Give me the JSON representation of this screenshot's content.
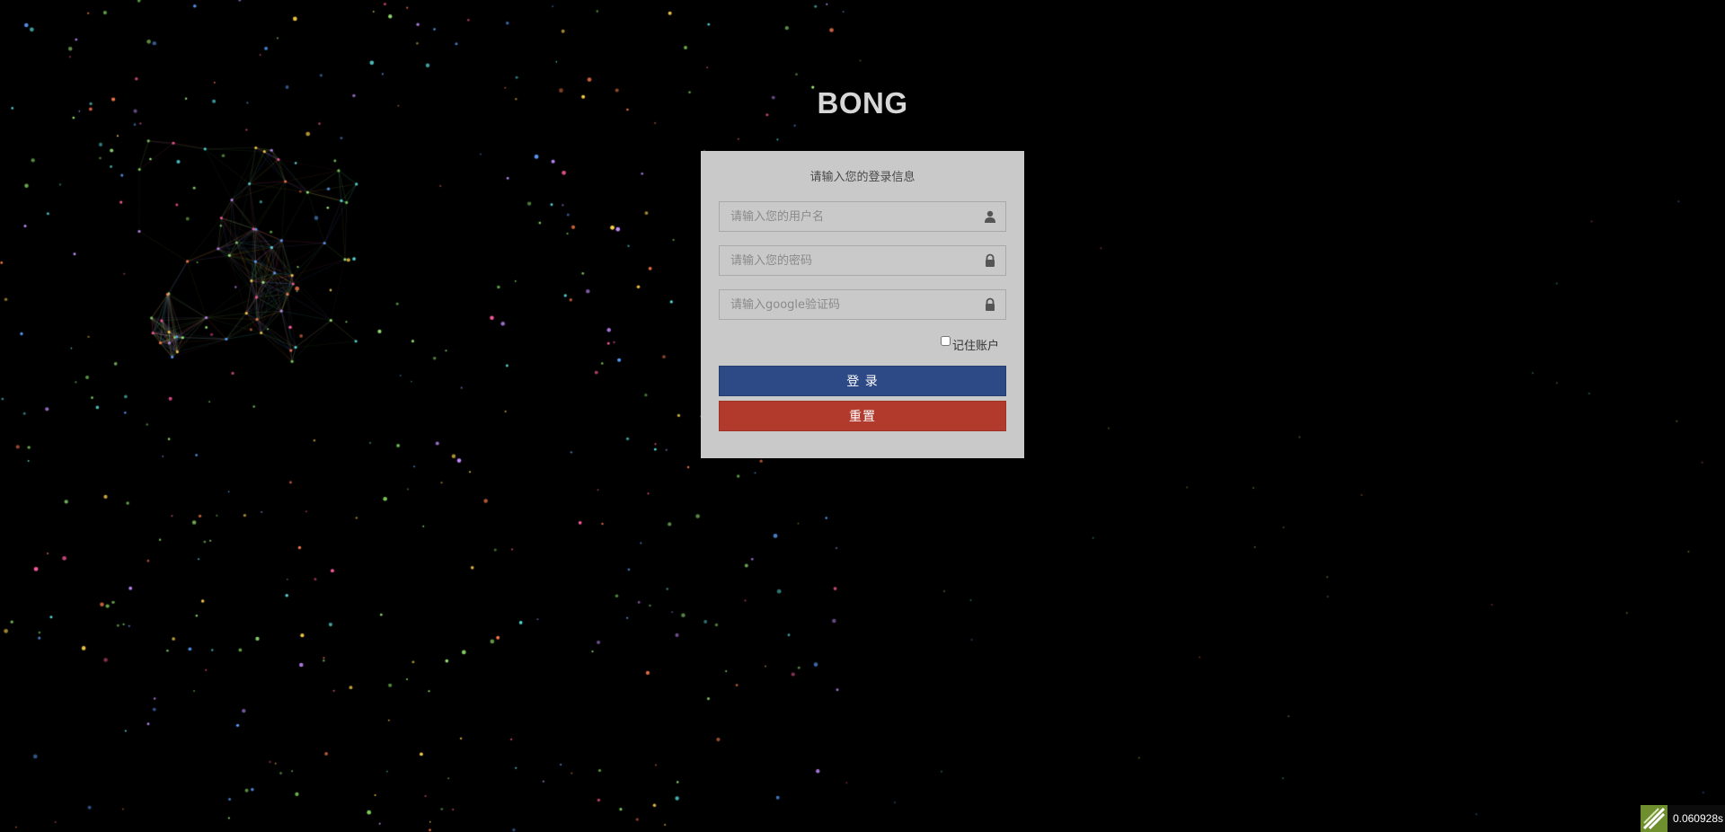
{
  "brand": "BONG",
  "login": {
    "heading": "请输入您的登录信息",
    "username_placeholder": "请输入您的用户名",
    "password_placeholder": "请输入您的密码",
    "google_placeholder": "请输入google验证码",
    "remember_label": "记住账户",
    "login_button": "登 录",
    "reset_button": "重置"
  },
  "timer": {
    "value": "0.060928s"
  },
  "icons": {
    "username": "user-icon",
    "password": "lock-icon",
    "google": "lock-icon",
    "timer": "debug-bar-logo-icon"
  },
  "colors": {
    "background": "#000000",
    "panel": "#c9c9c9",
    "login_button": "#2e4a86",
    "reset_button": "#b23a2d"
  }
}
